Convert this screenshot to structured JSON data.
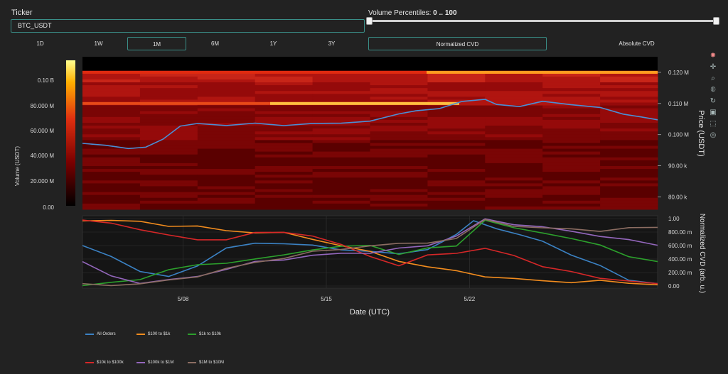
{
  "ticker": {
    "label": "Ticker",
    "value": "BTC_USDT"
  },
  "volume_percentiles": {
    "label": "Volume Percentiles:",
    "range": "0 .. 100",
    "low": 0,
    "high": 100
  },
  "timeframes": [
    {
      "label": "1D",
      "active": false
    },
    {
      "label": "1W",
      "active": false
    },
    {
      "label": "1M",
      "active": true
    },
    {
      "label": "6M",
      "active": false
    },
    {
      "label": "1Y",
      "active": false
    },
    {
      "label": "3Y",
      "active": false
    }
  ],
  "cvd_modes": [
    {
      "label": "Normalized CVD",
      "active": true
    },
    {
      "label": "Absolute CVD",
      "active": false
    }
  ],
  "colorbar": {
    "title": "Volume (USDT)",
    "ticks": [
      "0.10 B",
      "80.000 M",
      "60.000 M",
      "40.000 M",
      "20.000 M",
      "0.00"
    ]
  },
  "price_axis": {
    "title": "Price (USDT)",
    "ticks": [
      "0.120 M",
      "0.110 M",
      "0.100 M",
      "90.00 k",
      "80.00 k"
    ]
  },
  "cvd_axis": {
    "title": "Normalized CVD (arb. u.)",
    "ticks": [
      "1.00",
      "800.00 m",
      "600.00 m",
      "400.00 m",
      "200.00 m",
      "0.00"
    ]
  },
  "x_axis": {
    "title": "Date (UTC)",
    "ticks": [
      "5/08",
      "5/15",
      "5/22"
    ]
  },
  "legend": [
    {
      "name": "All Orders",
      "color": "#3b82c4"
    },
    {
      "name": "$100 to $1k",
      "color": "#f28c1e"
    },
    {
      "name": "$1k to $10k",
      "color": "#2ca02c"
    },
    {
      "name": "$10k to $100k",
      "color": "#d62728"
    },
    {
      "name": "$100k to $1M",
      "color": "#9467bd"
    },
    {
      "name": "$1M to $10M",
      "color": "#8c6d62"
    }
  ],
  "modebar_icons": [
    "plotly-logo-icon",
    "pan-icon",
    "zoom-icon",
    "lasso-icon",
    "reset-icon",
    "camera-icon",
    "hover-icon",
    "spike-icon"
  ],
  "chart_data": [
    {
      "type": "heatmap",
      "title": "",
      "xlabel": "",
      "ylabel": "Price (USDT)",
      "colorbar_label": "Volume (USDT)",
      "ylim": [
        76000,
        125000
      ],
      "price_line": {
        "name": "Price",
        "x": [
          0,
          0.04,
          0.08,
          0.11,
          0.14,
          0.17,
          0.2,
          0.25,
          0.3,
          0.35,
          0.4,
          0.45,
          0.5,
          0.55,
          0.58,
          0.62,
          0.66,
          0.7,
          0.72,
          0.76,
          0.8,
          0.85,
          0.9,
          0.94,
          0.97,
          1.0
        ],
        "y": [
          97200,
          96600,
          95500,
          96000,
          98500,
          102800,
          103500,
          103000,
          103600,
          103000,
          103500,
          103800,
          104200,
          106800,
          107500,
          108500,
          110500,
          111500,
          109500,
          109200,
          110500,
          109800,
          108500,
          106800,
          105500,
          105000
        ]
      }
    },
    {
      "type": "line",
      "title": "",
      "xlabel": "Date (UTC)",
      "ylabel": "Normalized CVD (arb. u.)",
      "ylim": [
        0,
        1
      ],
      "x_ticks": [
        "5/08",
        "5/15",
        "5/22"
      ],
      "series": [
        {
          "name": "All Orders",
          "x": [
            0,
            0.05,
            0.1,
            0.15,
            0.2,
            0.25,
            0.3,
            0.35,
            0.4,
            0.45,
            0.5,
            0.55,
            0.6,
            0.65,
            0.68,
            0.72,
            0.76,
            0.8,
            0.85,
            0.9,
            0.95,
            1.0
          ],
          "values": [
            0.6,
            0.45,
            0.2,
            0.15,
            0.3,
            0.55,
            0.65,
            0.62,
            0.6,
            0.55,
            0.5,
            0.48,
            0.55,
            0.75,
            0.98,
            0.85,
            0.75,
            0.68,
            0.45,
            0.3,
            0.1,
            0.02
          ]
        },
        {
          "name": "$100 to $1k",
          "x": [
            0,
            0.05,
            0.1,
            0.15,
            0.2,
            0.25,
            0.3,
            0.35,
            0.4,
            0.45,
            0.5,
            0.55,
            0.6,
            0.65,
            0.7,
            0.75,
            0.8,
            0.85,
            0.9,
            0.95,
            1.0
          ],
          "values": [
            0.98,
            0.97,
            0.95,
            0.9,
            0.88,
            0.82,
            0.8,
            0.78,
            0.7,
            0.6,
            0.5,
            0.38,
            0.28,
            0.22,
            0.15,
            0.1,
            0.08,
            0.06,
            0.07,
            0.05,
            0.02
          ]
        },
        {
          "name": "$1k to $10k",
          "x": [
            0,
            0.05,
            0.1,
            0.15,
            0.2,
            0.25,
            0.3,
            0.35,
            0.4,
            0.45,
            0.5,
            0.55,
            0.6,
            0.65,
            0.7,
            0.75,
            0.8,
            0.85,
            0.9,
            0.95,
            1.0
          ],
          "values": [
            0.02,
            0.04,
            0.1,
            0.25,
            0.3,
            0.35,
            0.4,
            0.45,
            0.55,
            0.58,
            0.6,
            0.48,
            0.55,
            0.6,
            0.98,
            0.85,
            0.8,
            0.7,
            0.6,
            0.45,
            0.35
          ]
        },
        {
          "name": "$10k to $100k",
          "x": [
            0,
            0.05,
            0.1,
            0.15,
            0.2,
            0.25,
            0.3,
            0.35,
            0.4,
            0.45,
            0.5,
            0.55,
            0.6,
            0.65,
            0.7,
            0.75,
            0.8,
            0.85,
            0.9,
            0.95,
            1.0
          ],
          "values": [
            0.98,
            0.92,
            0.85,
            0.75,
            0.68,
            0.7,
            0.78,
            0.8,
            0.75,
            0.6,
            0.45,
            0.3,
            0.45,
            0.5,
            0.55,
            0.45,
            0.3,
            0.2,
            0.12,
            0.08,
            0.02
          ]
        },
        {
          "name": "$100k to $1M",
          "x": [
            0,
            0.05,
            0.1,
            0.15,
            0.2,
            0.25,
            0.3,
            0.35,
            0.4,
            0.45,
            0.5,
            0.55,
            0.6,
            0.65,
            0.7,
            0.75,
            0.8,
            0.85,
            0.9,
            0.95,
            1.0
          ],
          "values": [
            0.35,
            0.15,
            0.05,
            0.08,
            0.15,
            0.25,
            0.35,
            0.4,
            0.45,
            0.48,
            0.5,
            0.55,
            0.6,
            0.75,
            0.98,
            0.92,
            0.88,
            0.8,
            0.75,
            0.68,
            0.6
          ]
        },
        {
          "name": "$1M to $10M",
          "x": [
            0,
            0.05,
            0.1,
            0.15,
            0.2,
            0.25,
            0.3,
            0.35,
            0.4,
            0.45,
            0.5,
            0.55,
            0.6,
            0.65,
            0.7,
            0.75,
            0.8,
            0.85,
            0.9,
            0.95,
            1.0
          ],
          "values": [
            0.02,
            0.02,
            0.03,
            0.08,
            0.15,
            0.25,
            0.35,
            0.42,
            0.5,
            0.55,
            0.6,
            0.62,
            0.65,
            0.7,
            0.98,
            0.9,
            0.85,
            0.85,
            0.82,
            0.85,
            0.88
          ]
        }
      ]
    }
  ]
}
